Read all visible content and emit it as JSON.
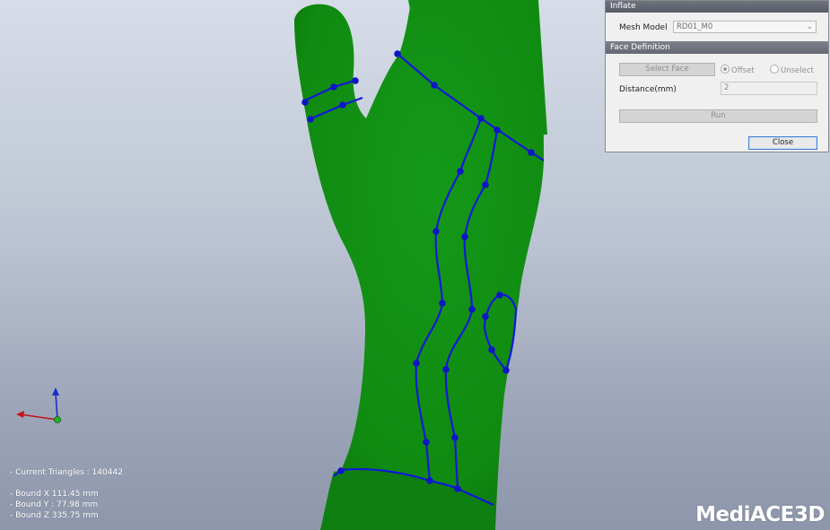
{
  "viewport": {
    "mesh_color": "#12870f",
    "curve_color": "#1118d8",
    "axes": {
      "x_color": "#c4161b",
      "y_color": "#1b2ec4",
      "z_color": "#24b324"
    }
  },
  "panel": {
    "title": "Inflate",
    "mesh_model": {
      "label": "Mesh Model",
      "value": "RD01_M0"
    },
    "face_definition": {
      "header": "Face Definition",
      "select_face_label": "Select Face",
      "offset_label": "Offset",
      "unselect_label": "Unselect",
      "offset_selected": true,
      "distance_label": "Distance(mm)",
      "distance_value": "2"
    },
    "run_label": "Run",
    "close_label": "Close"
  },
  "stats": {
    "triangles": "- Current Triangles : 140442",
    "bound_x": "- Bound X   111.45 mm",
    "bound_y": "- Bound Y : 77.98 mm",
    "bound_z": "- Bound Z   335.75 mm"
  },
  "brand": {
    "logo_text": "MediACE3D"
  }
}
